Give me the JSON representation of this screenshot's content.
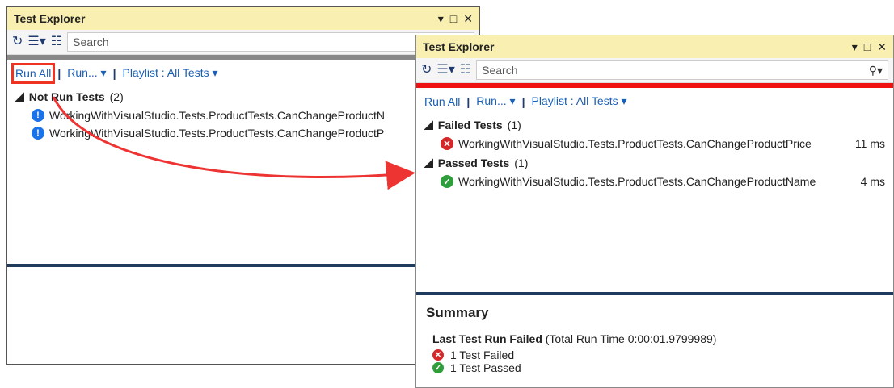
{
  "left_window": {
    "title": "Test Explorer",
    "search_placeholder": "Search",
    "links": {
      "run_all": "Run All",
      "run": "Run...",
      "playlist": "Playlist : All Tests"
    },
    "group": {
      "label": "Not Run Tests",
      "count": "(2)"
    },
    "tests": [
      "WorkingWithVisualStudio.Tests.ProductTests.CanChangeProductN",
      "WorkingWithVisualStudio.Tests.ProductTests.CanChangeProductP"
    ]
  },
  "right_window": {
    "title": "Test Explorer",
    "search_placeholder": "Search",
    "links": {
      "run_all": "Run All",
      "run": "Run...",
      "playlist": "Playlist : All Tests"
    },
    "failed_group": {
      "label": "Failed Tests",
      "count": "(1)"
    },
    "failed_tests": [
      {
        "name": "WorkingWithVisualStudio.Tests.ProductTests.CanChangeProductPrice",
        "duration": "11 ms"
      }
    ],
    "passed_group": {
      "label": "Passed Tests",
      "count": "(1)"
    },
    "passed_tests": [
      {
        "name": "WorkingWithVisualStudio.Tests.ProductTests.CanChangeProductName",
        "duration": "4 ms"
      }
    ],
    "summary": {
      "heading": "Summary",
      "last_run_label": "Last Test Run Failed",
      "total_time": "(Total Run Time 0:00:01.9799989)",
      "failed_count": "1 Test Failed",
      "passed_count": "1 Test Passed"
    }
  },
  "colors": {
    "title_bg": "#f8efb0",
    "link": "#1a5fb4",
    "failed": "#d62828",
    "passed": "#2e9e3b",
    "not_run": "#1a73e8",
    "accent_red": "#ee1111",
    "divider": "#1e3a5f"
  }
}
